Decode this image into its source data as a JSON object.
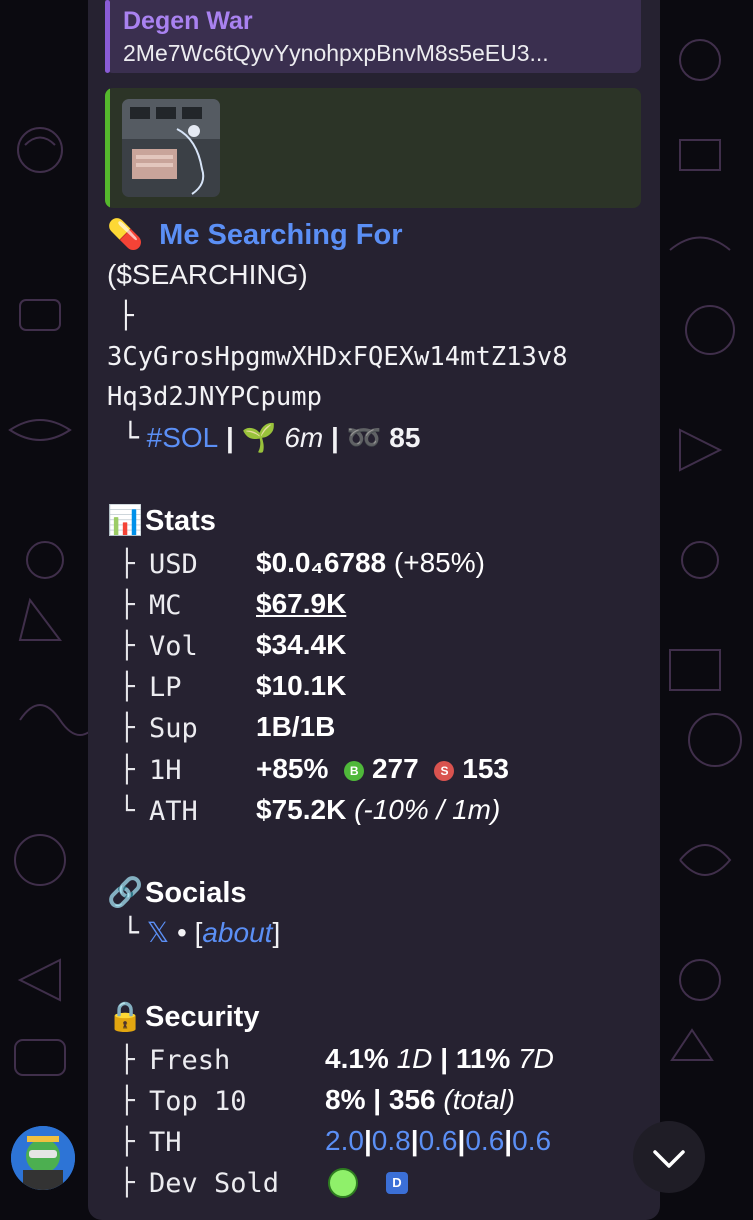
{
  "reply": {
    "title": "Degen War",
    "text": "2Me7Wc6tQyvYynohpxpBnvM8s5eEU3..."
  },
  "token": {
    "name_emoji": "💊",
    "name": "Me Searching For",
    "ticker": "($SEARCHING)",
    "branch1": "├",
    "address_line1": "3CyGrosHpgmwXHDxFQEXw14mtZ13v8",
    "address_line2": "Hq3d2JNYPCpump",
    "branch2": "└",
    "chain": "#SOL",
    "sep": "|",
    "age_emoji": "🌱",
    "age": "6m",
    "holders_emoji": "➿",
    "holders": "85"
  },
  "stats": {
    "emoji": "📊",
    "title": "Stats",
    "rows": [
      {
        "branch": "├",
        "key": "USD",
        "value": "$0.0₄6788",
        "extra": "(+85%)"
      },
      {
        "branch": "├",
        "key": "MC",
        "value": "$67.9K"
      },
      {
        "branch": "├",
        "key": "Vol",
        "value": "$34.4K"
      },
      {
        "branch": "├",
        "key": "LP",
        "value": "$10.1K"
      },
      {
        "branch": "├",
        "key": "Sup",
        "value": "1B/1B"
      },
      {
        "branch": "├",
        "key": "1H",
        "value": "+85%",
        "buy_badge": "B",
        "buys": "277",
        "sell_badge": "S",
        "sells": "153"
      },
      {
        "branch": "└",
        "key": "ATH",
        "value": "$75.2K",
        "extra": "(-10% / 1m)"
      }
    ]
  },
  "socials": {
    "emoji": "🔗",
    "title": "Socials",
    "branch": "└",
    "x_link": "𝕏",
    "dot": "•",
    "open_bracket": "[",
    "about": "about",
    "close_bracket": "]"
  },
  "security": {
    "emoji": "🔒",
    "title": "Security",
    "rows": [
      {
        "branch": "├",
        "key": "Fresh",
        "v1": "4.1%",
        "v1s": "1D",
        "sep": "|",
        "v2": "11%",
        "v2s": "7D"
      },
      {
        "branch": "├",
        "key": "Top 10",
        "v1": "8%",
        "sep": "|",
        "v2": "356",
        "v2s": "(total)"
      },
      {
        "branch": "├",
        "key": "TH",
        "holders": [
          "2.0",
          "0.8",
          "0.6",
          "0.6",
          "0.6"
        ],
        "sep": "|"
      },
      {
        "branch": "├",
        "key": "Dev Sold",
        "dev_badge": "D"
      }
    ]
  },
  "colors": {
    "accent_blue": "#5b8ff5",
    "reply_purple": "#a982f0",
    "preview_green": "#55b82d",
    "buy_green": "#4fb83a",
    "sell_red": "#d9534f",
    "bubble": "#262231"
  },
  "icons": {
    "scroll_down": "chevron-down-icon",
    "avatar": "user-avatar"
  }
}
